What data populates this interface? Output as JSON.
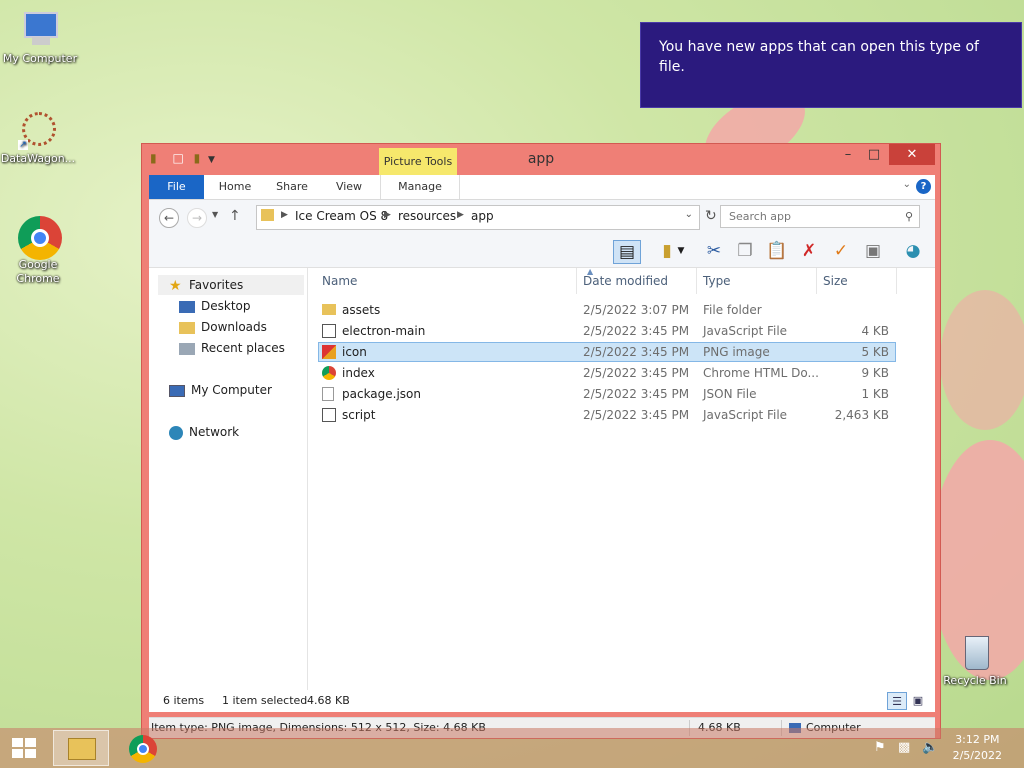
{
  "desktop": {
    "icons": [
      {
        "label": "My Computer"
      },
      {
        "label": "DataWagon..."
      },
      {
        "label": "Google Chrome"
      },
      {
        "label": "Recycle Bin"
      }
    ]
  },
  "notification": {
    "text": "You have new apps that can open this type of file."
  },
  "window": {
    "title": "app",
    "context_tab": "Picture Tools",
    "ribbon_tabs": [
      "File",
      "Home",
      "Share",
      "View",
      "Manage"
    ],
    "path": [
      "Ice Cream OS 8",
      "resources",
      "app"
    ],
    "search_placeholder": "Search app",
    "nav": {
      "favorites": "Favorites",
      "desktop": "Desktop",
      "downloads": "Downloads",
      "recent": "Recent places",
      "computer": "My Computer",
      "network": "Network"
    },
    "columns": {
      "name": "Name",
      "date": "Date modified",
      "type": "Type",
      "size": "Size"
    },
    "files": [
      {
        "name": "assets",
        "date": "2/5/2022 3:07 PM",
        "type": "File folder",
        "size": "",
        "icon": "folder-icon"
      },
      {
        "name": "electron-main",
        "date": "2/5/2022 3:45 PM",
        "type": "JavaScript File",
        "size": "4 KB",
        "icon": "script-file-icon"
      },
      {
        "name": "icon",
        "date": "2/5/2022 3:45 PM",
        "type": "PNG image",
        "size": "5 KB",
        "icon": "image-file-icon",
        "selected": true
      },
      {
        "name": "index",
        "date": "2/5/2022 3:45 PM",
        "type": "Chrome HTML Do...",
        "size": "9 KB",
        "icon": "chrome-file-icon"
      },
      {
        "name": "package.json",
        "date": "2/5/2022 3:45 PM",
        "type": "JSON File",
        "size": "1 KB",
        "icon": "blank-file-icon"
      },
      {
        "name": "script",
        "date": "2/5/2022 3:45 PM",
        "type": "JavaScript File",
        "size": "2,463 KB",
        "icon": "script-file-icon"
      }
    ],
    "status": {
      "items": "6 items",
      "selected": "1 item selected",
      "size": "4.68 KB"
    },
    "details": {
      "info": "Item type: PNG image, Dimensions: 512 x 512, Size: 4.68 KB",
      "size": "4.68 KB",
      "location": "Computer"
    }
  },
  "taskbar": {
    "time": "3:12 PM",
    "date": "2/5/2022"
  },
  "colors": {
    "window_frame": "#ef7f76",
    "file_tab": "#1a66c6",
    "toast": "#2b1a7e",
    "close": "#c9413a"
  }
}
